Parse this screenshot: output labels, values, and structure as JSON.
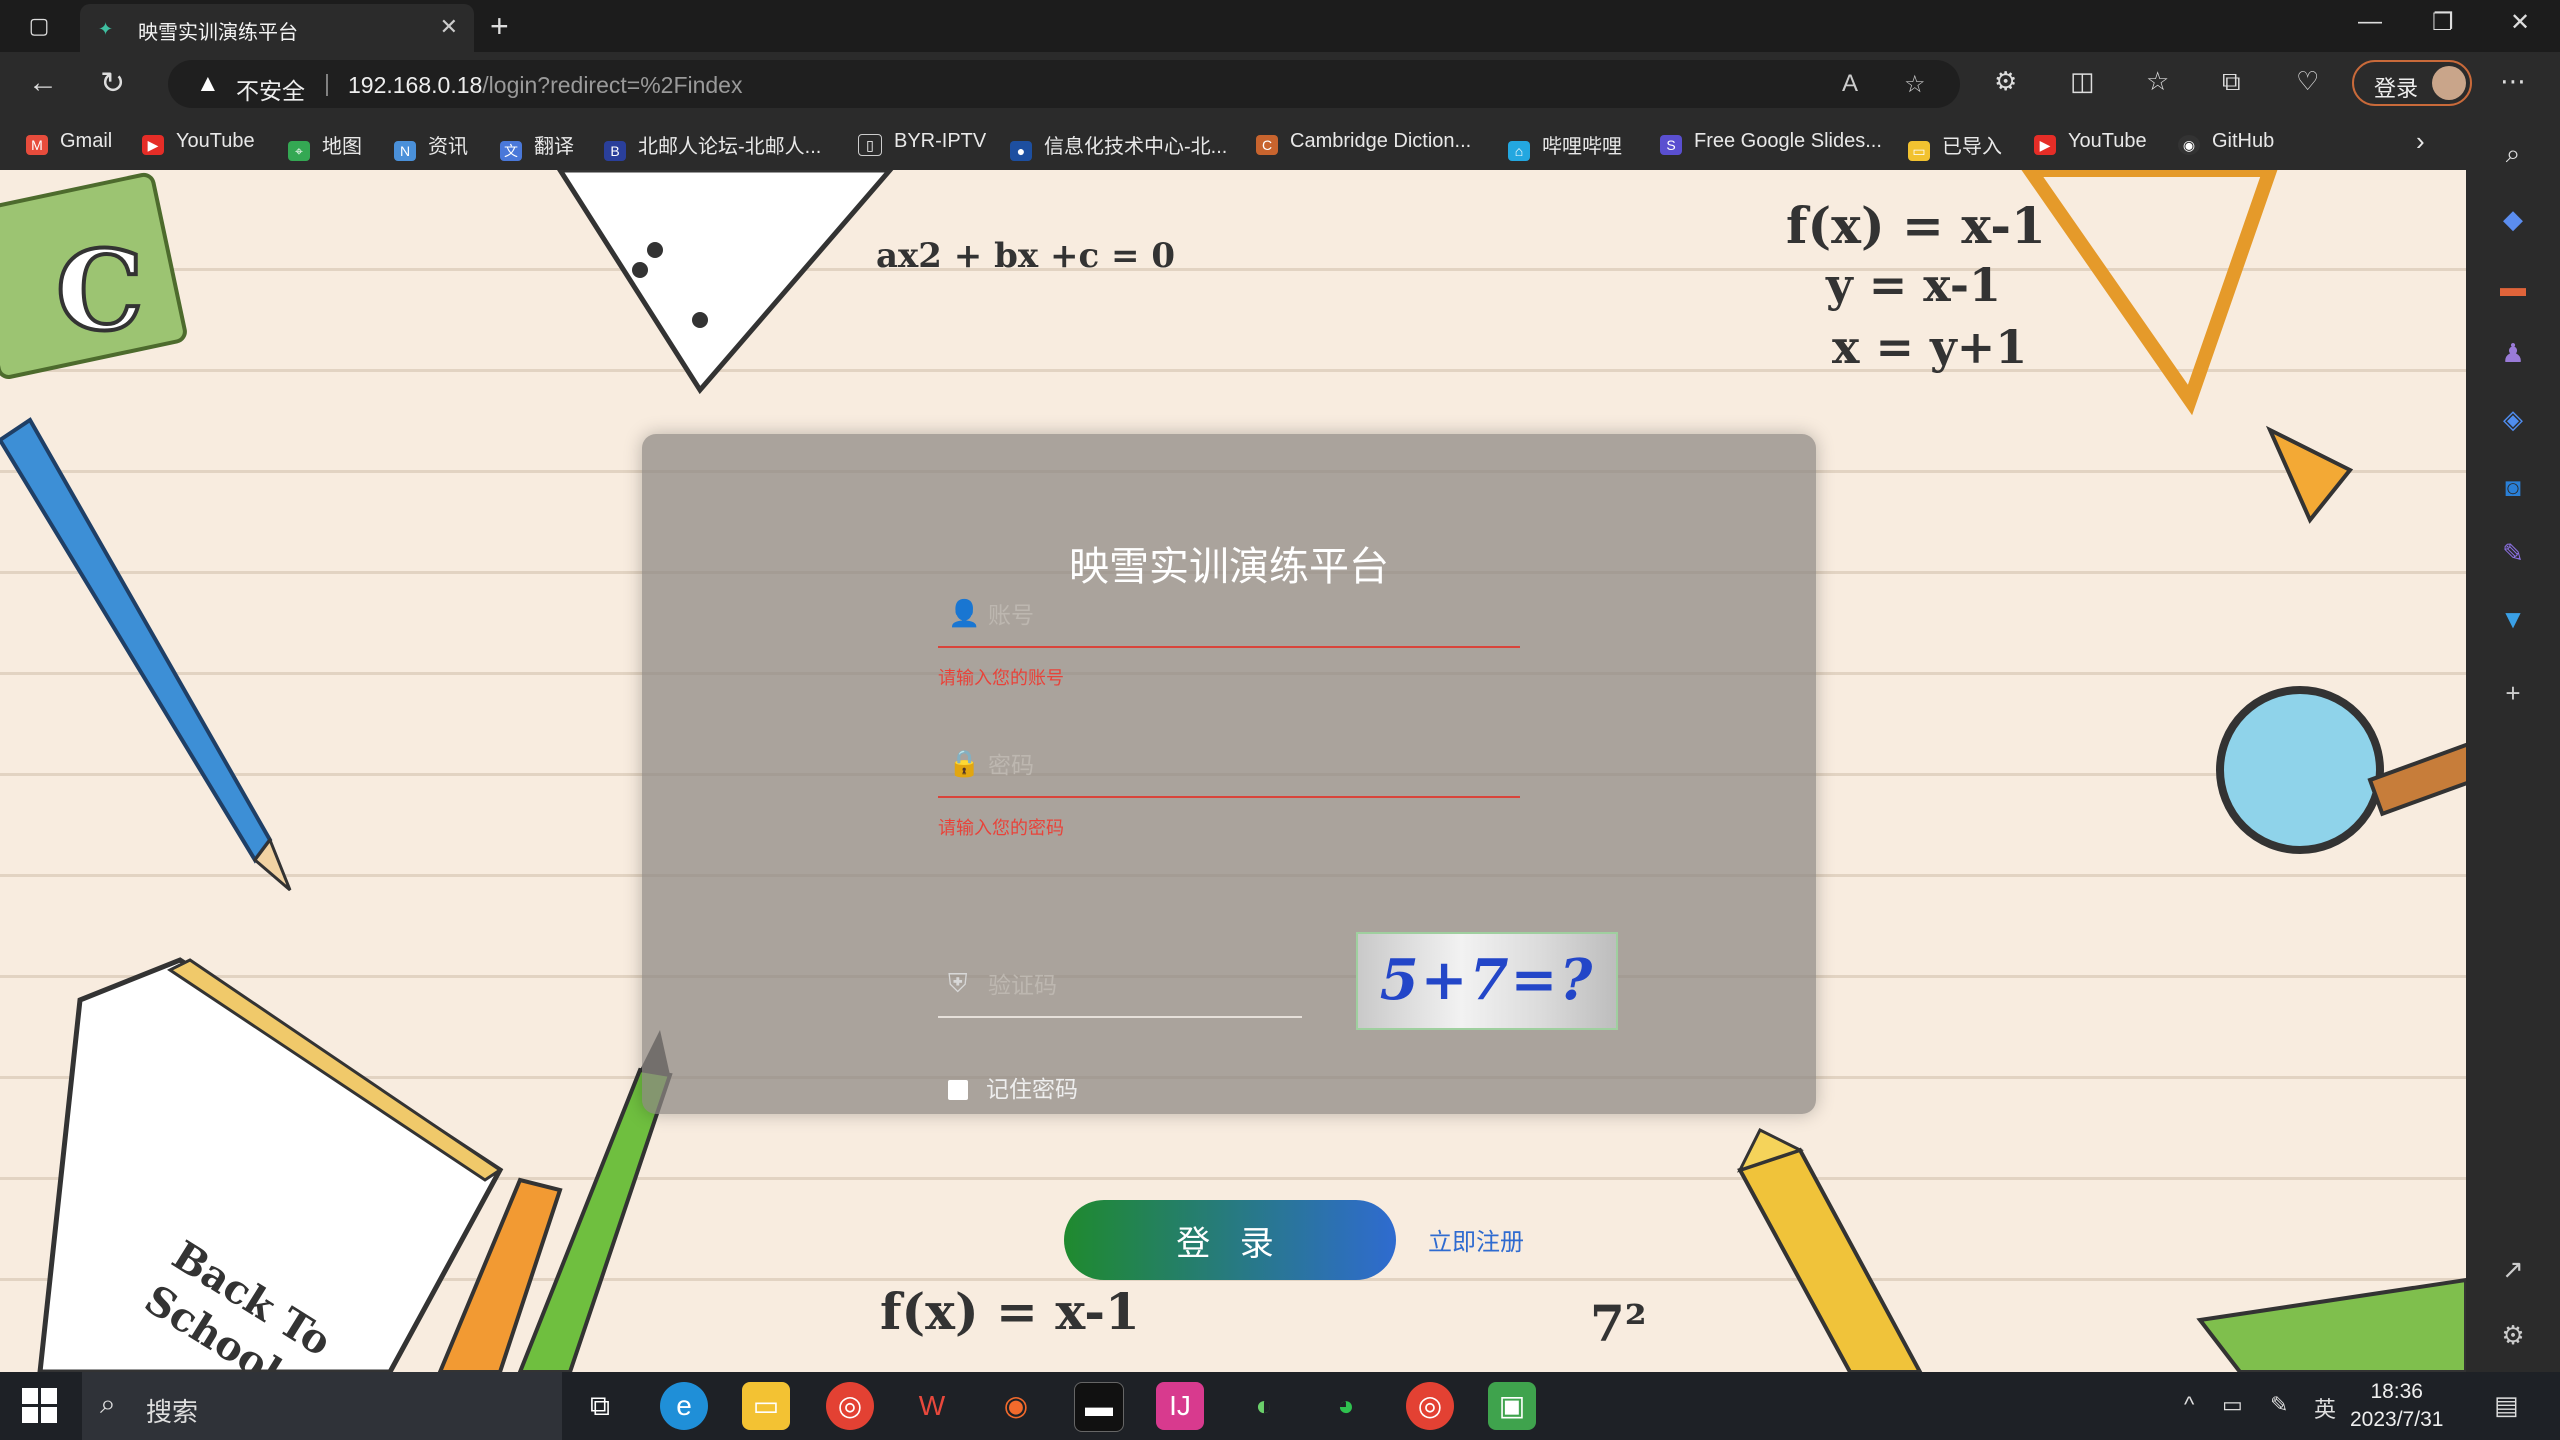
{
  "browser": {
    "tab_title": "映雪实训演练平台",
    "tab_close": "✕",
    "new_tab": "+",
    "url_security": "不安全",
    "url_host": "192.168.0.18",
    "url_path": "/login?redirect=%2Findex",
    "profile_label": "登录"
  },
  "bookmarks": [
    {
      "label": "Gmail",
      "icon": "gmail-icon",
      "color": "#e74c3c"
    },
    {
      "label": "YouTube",
      "icon": "youtube-icon",
      "color": "#e52d27"
    },
    {
      "label": "地图",
      "icon": "maps-icon",
      "color": "#34a853"
    },
    {
      "label": "资讯",
      "icon": "news-icon",
      "color": "#4a90d9"
    },
    {
      "label": "翻译",
      "icon": "translate-icon",
      "color": "#4a78d9"
    },
    {
      "label": "北邮人论坛-北邮人...",
      "icon": "forum-icon",
      "color": "#2a3f9a"
    },
    {
      "label": "BYR-IPTV",
      "icon": "file-icon",
      "color": "#555555"
    },
    {
      "label": "信息化技术中心-北...",
      "icon": "org-icon",
      "color": "#1d4fa0"
    },
    {
      "label": "Cambridge Diction...",
      "icon": "cambridge-icon",
      "color": "#c8642e"
    },
    {
      "label": "哔哩哔哩",
      "icon": "bilibili-icon",
      "color": "#23a7e0"
    },
    {
      "label": "Free Google Slides...",
      "icon": "slides-icon",
      "color": "#5a4fd0"
    },
    {
      "label": "已导入",
      "icon": "folder-icon",
      "color": "#f2c230"
    },
    {
      "label": "YouTube",
      "icon": "youtube-icon",
      "color": "#e52d27"
    },
    {
      "label": "GitHub",
      "icon": "github-icon",
      "color": "#333333"
    }
  ],
  "page": {
    "math_lines": [
      "ax2 + bx +c = 0",
      "f(x) = x-1",
      "y = x-1",
      "x = y+1",
      "f(x) = x-1",
      "7²"
    ],
    "notebook_text": "Back To School",
    "letter": "C"
  },
  "login": {
    "title": "映雪实训演练平台",
    "account_placeholder": "账号",
    "account_error": "请输入您的账号",
    "password_placeholder": "密码",
    "password_error": "请输入您的密码",
    "captcha_placeholder": "验证码",
    "captcha_text": "5+7=?",
    "remember_label": "记住密码",
    "submit_label": "登 录",
    "register_label": "立即注册"
  },
  "taskbar": {
    "search_label": "搜索",
    "ime": "英",
    "time": "18:36",
    "date": "2023/7/31"
  }
}
